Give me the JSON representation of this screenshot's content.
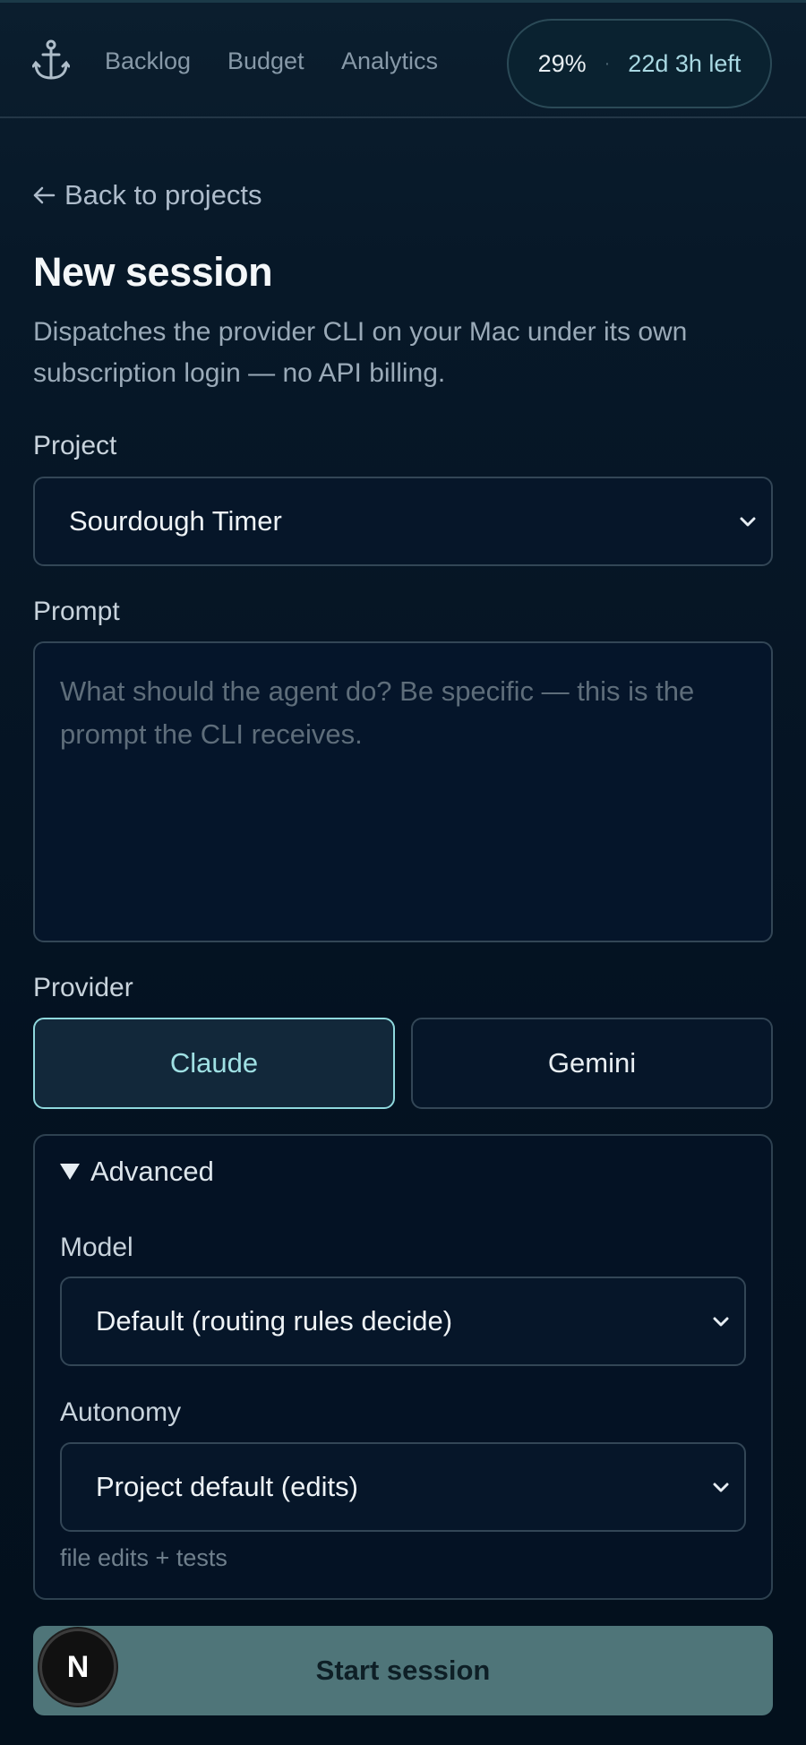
{
  "nav": {
    "logo_icon": "anchor-icon",
    "links": [
      {
        "label": "Backlog"
      },
      {
        "label": "Budget"
      },
      {
        "label": "Analytics"
      }
    ],
    "usage": {
      "percent": "29%",
      "separator": "·",
      "time_left": "22d 3h left"
    }
  },
  "page": {
    "back_label": "Back to projects",
    "title": "New session",
    "description": "Dispatches the provider CLI on your Mac under its own subscription login — no API billing."
  },
  "form": {
    "project": {
      "label": "Project",
      "value": "Sourdough Timer"
    },
    "prompt": {
      "label": "Prompt",
      "placeholder": "What should the agent do? Be specific — this is the prompt the CLI receives.",
      "value": ""
    },
    "provider": {
      "label": "Provider",
      "options": [
        {
          "label": "Claude",
          "selected": true
        },
        {
          "label": "Gemini",
          "selected": false
        }
      ]
    },
    "advanced": {
      "summary": "Advanced",
      "expanded": true,
      "model": {
        "label": "Model",
        "value": "Default (routing rules decide)"
      },
      "autonomy": {
        "label": "Autonomy",
        "value": "Project default (edits)",
        "hint": "file edits + tests"
      }
    },
    "submit_label": "Start session"
  },
  "badge": {
    "letter": "N"
  },
  "colors": {
    "accent": "#8fd8dd",
    "button_bg": "#4f7579",
    "background": "#041220"
  }
}
